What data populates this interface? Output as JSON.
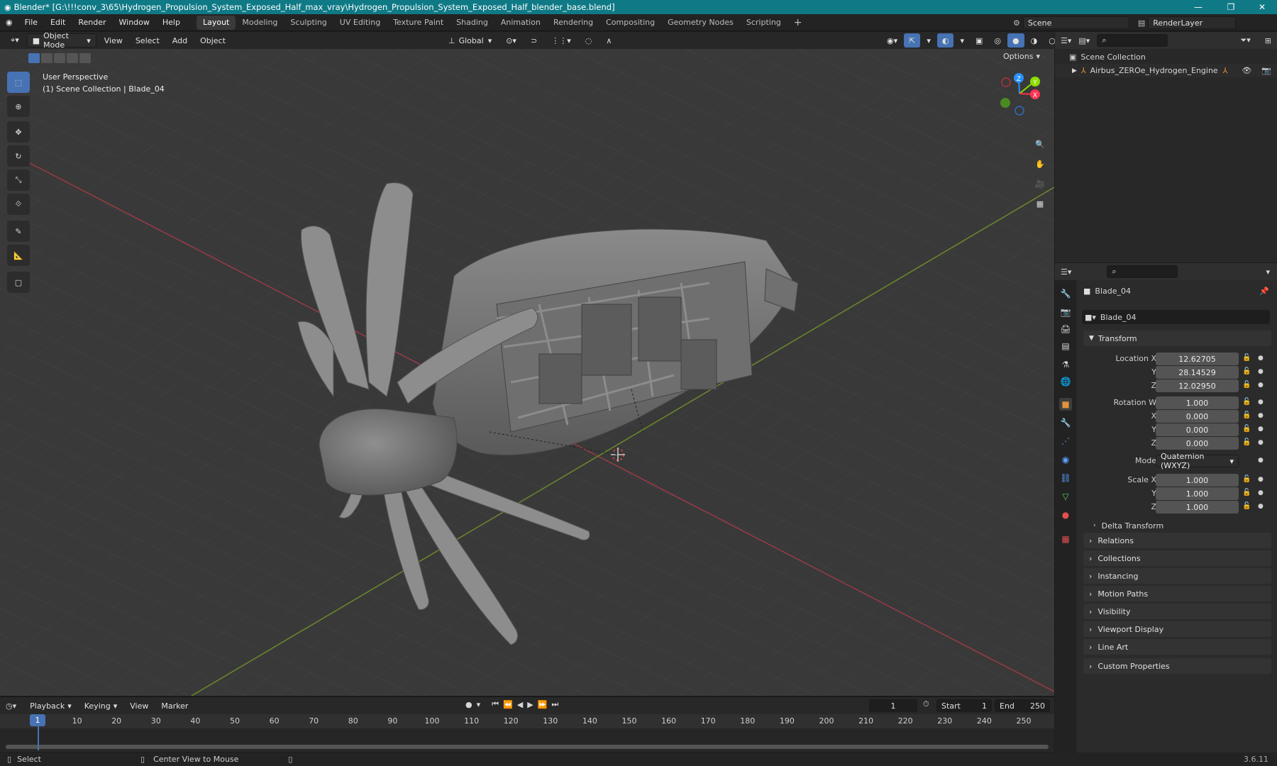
{
  "titlebar": {
    "title": "Blender* [G:\\!!!conv_3\\65\\Hydrogen_Propulsion_System_Exposed_Half_max_vray\\Hydrogen_Propulsion_System_Exposed_Half_blender_base.blend]"
  },
  "menus": [
    "File",
    "Edit",
    "Render",
    "Window",
    "Help"
  ],
  "workspaces": [
    "Layout",
    "Modeling",
    "Sculpting",
    "UV Editing",
    "Texture Paint",
    "Shading",
    "Animation",
    "Rendering",
    "Compositing",
    "Geometry Nodes",
    "Scripting"
  ],
  "active_workspace": "Layout",
  "scene": {
    "name": "Scene",
    "view_layer": "RenderLayer"
  },
  "viewport_header": {
    "mode": "Object Mode",
    "menus": [
      "View",
      "Select",
      "Add",
      "Object"
    ],
    "orientation": "Global",
    "options": "Options"
  },
  "viewport": {
    "perspective": "User Perspective",
    "collection_info": "(1) Scene Collection | Blade_04"
  },
  "gizmo": {
    "x": "X",
    "y": "Y",
    "z": "Z"
  },
  "outliner": {
    "root": "Scene Collection",
    "item": "Airbus_ZEROe_Hydrogen_Engine"
  },
  "properties": {
    "object_name": "Blade_04",
    "data_name": "Blade_04",
    "transform_header": "Transform",
    "location": {
      "label": "Location X",
      "x": "12.62705",
      "y": "28.14529",
      "z": "12.02950"
    },
    "rotation": {
      "label": "Rotation W",
      "w": "1.000",
      "x": "0.000",
      "y": "0.000",
      "z": "0.000"
    },
    "mode_label": "Mode",
    "mode": "Quaternion (WXYZ)",
    "scale": {
      "label": "Scale X",
      "x": "1.000",
      "y": "1.000",
      "z": "1.000"
    },
    "axis_labels": {
      "x": "X",
      "y": "Y",
      "z": "Z"
    },
    "delta": "Delta Transform",
    "panels": [
      "Relations",
      "Collections",
      "Instancing",
      "Motion Paths",
      "Visibility",
      "Viewport Display",
      "Line Art",
      "Custom Properties"
    ]
  },
  "timeline": {
    "menus": [
      "Playback",
      "Keying",
      "View",
      "Marker"
    ],
    "current_frame": "1",
    "start_label": "Start",
    "start": "1",
    "end_label": "End",
    "end": "250",
    "ticks": [
      "10",
      "20",
      "30",
      "40",
      "50",
      "60",
      "70",
      "80",
      "90",
      "100",
      "110",
      "120",
      "130",
      "140",
      "150",
      "160",
      "170",
      "180",
      "190",
      "200",
      "210",
      "220",
      "230",
      "240",
      "250"
    ],
    "playhead": "1"
  },
  "statusbar": {
    "select": "Select",
    "center": "Center View to Mouse",
    "version": "3.6.11"
  },
  "colors": {
    "accent": "#4772b3",
    "titlebar": "#0f7a86",
    "x_axis": "#ff3352",
    "y_axis": "#8bdc00",
    "z_axis": "#2890ff"
  }
}
